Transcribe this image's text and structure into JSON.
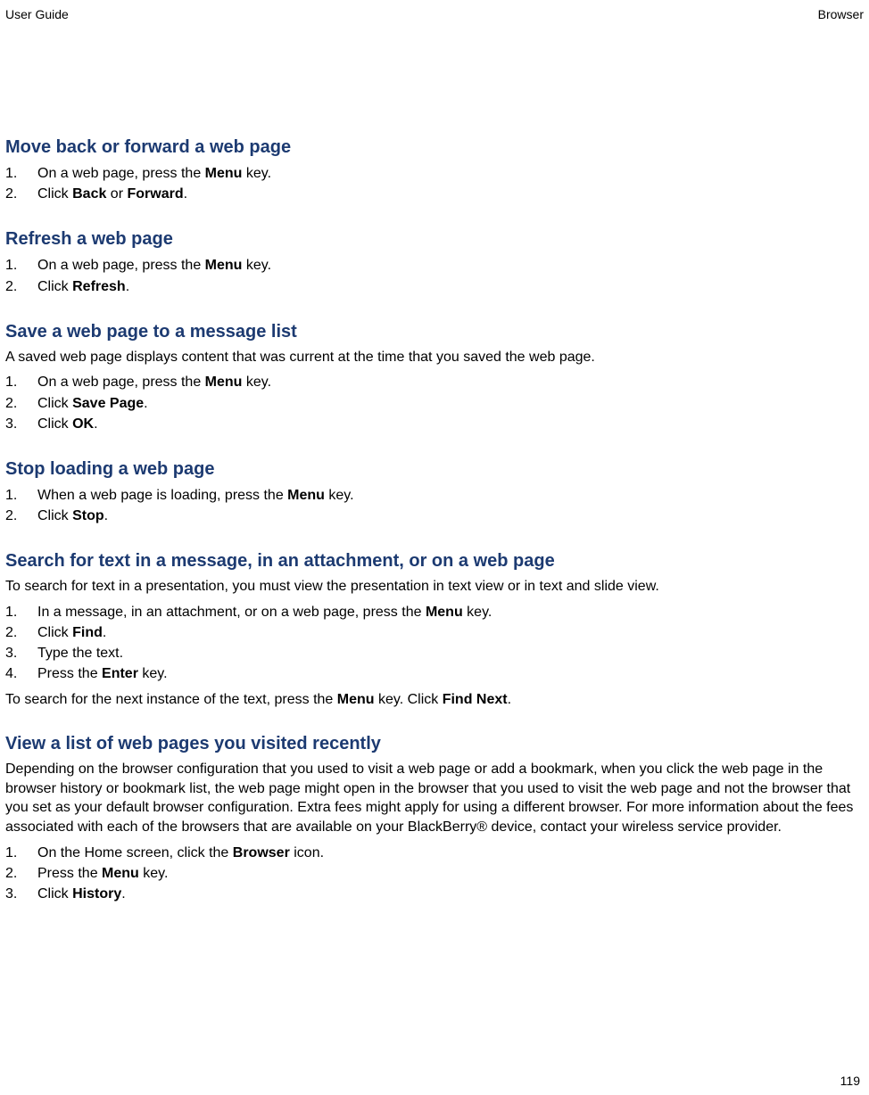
{
  "header": {
    "left": "User Guide",
    "right": "Browser"
  },
  "page_number": "119",
  "sections": [
    {
      "heading": "Move back or forward a web page",
      "intro": [],
      "steps": [
        [
          {
            "t": "On a web page, press the "
          },
          {
            "t": "Menu",
            "b": true
          },
          {
            "t": " key."
          }
        ],
        [
          {
            "t": "Click "
          },
          {
            "t": "Back",
            "b": true
          },
          {
            "t": " or "
          },
          {
            "t": "Forward",
            "b": true
          },
          {
            "t": "."
          }
        ]
      ],
      "outro": []
    },
    {
      "heading": "Refresh a web page",
      "intro": [],
      "steps": [
        [
          {
            "t": "On a web page, press the "
          },
          {
            "t": "Menu",
            "b": true
          },
          {
            "t": " key."
          }
        ],
        [
          {
            "t": "Click "
          },
          {
            "t": "Refresh",
            "b": true
          },
          {
            "t": "."
          }
        ]
      ],
      "outro": []
    },
    {
      "heading": "Save a web page to a message list",
      "intro": [
        [
          {
            "t": "A saved web page displays content that was current at the time that you saved the web page."
          }
        ]
      ],
      "steps": [
        [
          {
            "t": "On a web page, press the "
          },
          {
            "t": "Menu",
            "b": true
          },
          {
            "t": " key."
          }
        ],
        [
          {
            "t": "Click "
          },
          {
            "t": "Save Page",
            "b": true
          },
          {
            "t": "."
          }
        ],
        [
          {
            "t": "Click "
          },
          {
            "t": "OK",
            "b": true
          },
          {
            "t": "."
          }
        ]
      ],
      "outro": []
    },
    {
      "heading": "Stop loading a web page",
      "intro": [],
      "steps": [
        [
          {
            "t": "When a web page is loading, press the "
          },
          {
            "t": "Menu",
            "b": true
          },
          {
            "t": " key."
          }
        ],
        [
          {
            "t": "Click "
          },
          {
            "t": "Stop",
            "b": true
          },
          {
            "t": "."
          }
        ]
      ],
      "outro": []
    },
    {
      "heading": "Search for text in a message, in an attachment, or on a web page",
      "intro": [
        [
          {
            "t": "To search for text in a presentation, you must view the presentation in text view or in text and slide view."
          }
        ]
      ],
      "steps": [
        [
          {
            "t": "In a message, in an attachment, or on a web page, press the "
          },
          {
            "t": "Menu",
            "b": true
          },
          {
            "t": " key."
          }
        ],
        [
          {
            "t": "Click "
          },
          {
            "t": "Find",
            "b": true
          },
          {
            "t": "."
          }
        ],
        [
          {
            "t": "Type the text."
          }
        ],
        [
          {
            "t": "Press the "
          },
          {
            "t": "Enter",
            "b": true
          },
          {
            "t": " key."
          }
        ]
      ],
      "outro": [
        [
          {
            "t": "To search for the next instance of the text, press the "
          },
          {
            "t": "Menu",
            "b": true
          },
          {
            "t": " key. Click "
          },
          {
            "t": "Find Next",
            "b": true
          },
          {
            "t": "."
          }
        ]
      ]
    },
    {
      "heading": "View a list of web pages you visited recently",
      "intro": [
        [
          {
            "t": "Depending on the browser configuration that you used to visit a web page or add a bookmark, when you click the web page in the browser history or bookmark list, the web page might open in the browser that you used to visit the web page and not the browser that you set as your default browser configuration. Extra fees might apply for using a different browser. For more information about the fees associated with each of the browsers that are available on your BlackBerry® device, contact your wireless service provider."
          }
        ]
      ],
      "steps": [
        [
          {
            "t": "On the Home screen, click the "
          },
          {
            "t": "Browser",
            "b": true
          },
          {
            "t": " icon."
          }
        ],
        [
          {
            "t": "Press the "
          },
          {
            "t": "Menu",
            "b": true
          },
          {
            "t": " key."
          }
        ],
        [
          {
            "t": "Click "
          },
          {
            "t": "History",
            "b": true
          },
          {
            "t": "."
          }
        ]
      ],
      "outro": []
    }
  ]
}
